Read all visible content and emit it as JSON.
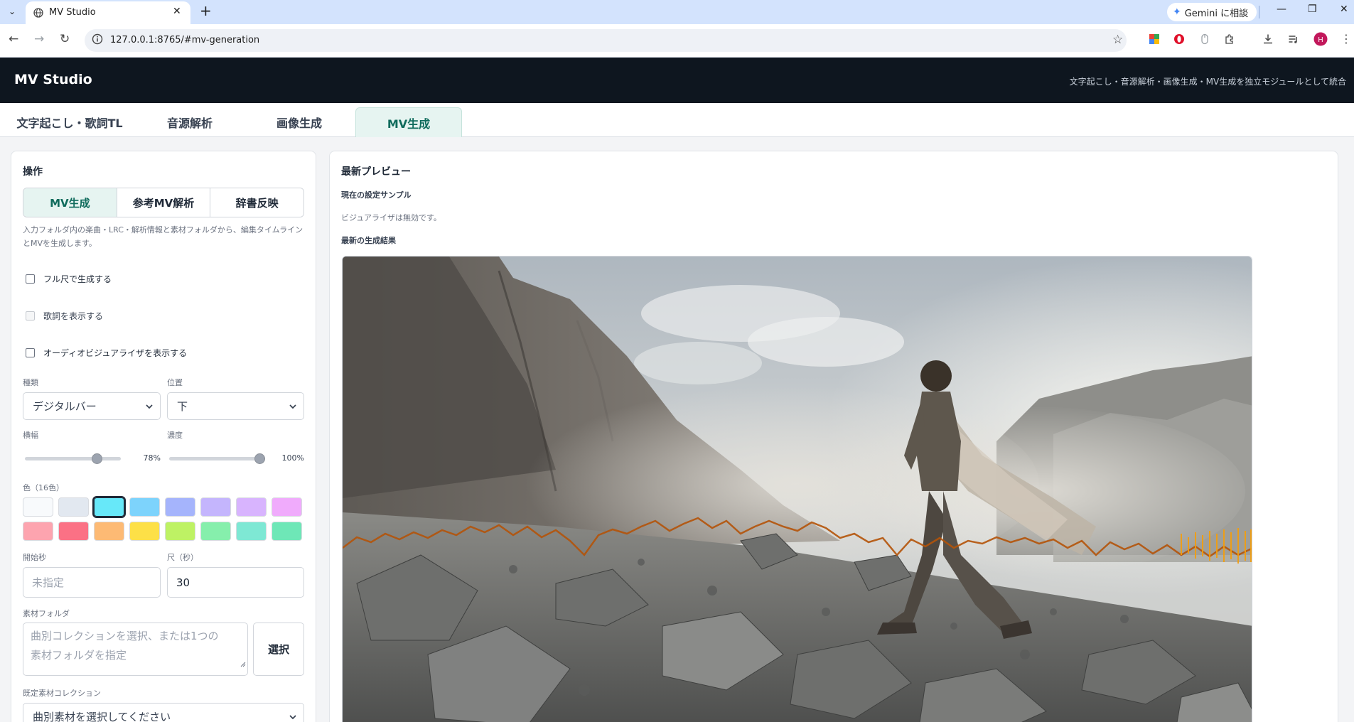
{
  "browser": {
    "tab_title": "MV Studio",
    "url": "127.0.0.1:8765/#mv-generation",
    "gemini_label": "Gemini に相談",
    "profile_initial": "H"
  },
  "app": {
    "title": "MV Studio",
    "subtitle": "文字起こし・音源解析・画像生成・MV生成を独立モジュールとして統合"
  },
  "module_tabs": [
    {
      "label": "文字起こし・歌詞TL",
      "active": false
    },
    {
      "label": "音源解析",
      "active": false
    },
    {
      "label": "画像生成",
      "active": false
    },
    {
      "label": "MV生成",
      "active": true
    }
  ],
  "left": {
    "heading": "操作",
    "modes": [
      {
        "label": "MV生成",
        "active": true
      },
      {
        "label": "参考MV解析",
        "active": false
      },
      {
        "label": "辞書反映",
        "active": false
      }
    ],
    "help": "入力フォルダ内の楽曲・LRC・解析情報と素材フォルダから、編集タイムラインとMVを生成します。",
    "checks": [
      {
        "label": "フル尺で生成する",
        "checked": false,
        "disabled": false
      },
      {
        "label": "歌詞を表示する",
        "checked": false,
        "disabled": true
      },
      {
        "label": "オーディオビジュアライザを表示する",
        "checked": false,
        "disabled": false
      }
    ],
    "type_label": "種類",
    "type_value": "デジタルバー",
    "position_label": "位置",
    "position_value": "下",
    "width_label": "横幅",
    "width_value": "78%",
    "width_fraction": 0.78,
    "opacity_label": "濃度",
    "opacity_value": "100%",
    "opacity_fraction": 1.0,
    "color_label": "色（16色）",
    "colors": [
      "#f8fafc",
      "#e2e8f0",
      "#67e8f9",
      "#7dd3fc",
      "#a5b4fc",
      "#c4b5fd",
      "#d8b4fe",
      "#f0abfc",
      "#fda4af",
      "#fb7185",
      "#fdba74",
      "#fde047",
      "#bef264",
      "#86efac",
      "#7ee8d4",
      "#6ee7b7"
    ],
    "selected_color_index": 2,
    "start_label": "開始秒",
    "start_placeholder": "未指定",
    "duration_label": "尺（秒）",
    "duration_value": "30",
    "material_label": "素材フォルダ",
    "material_placeholder_1": "曲別コレクションを選択、または1つの",
    "material_placeholder_2": "素材フォルダを指定",
    "select_button": "選択",
    "collection_label": "既定素材コレクション",
    "collection_value": "曲別素材を選択してください"
  },
  "right": {
    "heading": "最新プレビュー",
    "sample_heading": "現在の設定サンプル",
    "visualizer_note": "ビジュアライザは無効です。",
    "result_heading": "最新の生成結果"
  }
}
